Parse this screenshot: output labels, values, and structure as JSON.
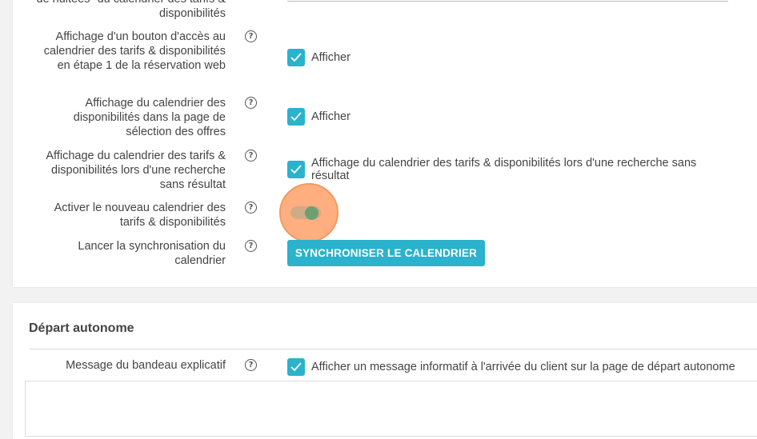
{
  "calendar_settings": {
    "partial_label": "de nuitées\" du calendrier des tarifs & disponibilités",
    "rows": [
      {
        "label": "Affichage d'un bouton d'accès au calendrier des tarifs & disponibilités en étape 1 de la réservation web",
        "checkbox_label": "Afficher",
        "checked": true
      },
      {
        "label": "Affichage du calendrier des disponibilités dans la page de sélection des offres",
        "checkbox_label": "Afficher",
        "checked": true
      },
      {
        "label": "Affichage du calendrier des tarifs & disponibilités lors d'une recherche sans résultat",
        "checkbox_label": "Affichage du calendrier des tarifs & disponibilités lors d'une recherche sans résultat",
        "checked": true
      }
    ],
    "new_calendar": {
      "label": "Activer le nouveau calendrier des tarifs & disponibilités",
      "enabled": true
    },
    "sync": {
      "label": "Lancer la synchronisation du calendrier",
      "button_label": "SYNCHRONISER LE CALENDRIER"
    }
  },
  "autonomous_departure": {
    "title": "Départ autonome",
    "banner_label": "Message du bandeau explicatif",
    "checkbox_label": "Afficher un message informatif à l'arrivée du client sur la page de départ autonome",
    "checked": true
  },
  "help_icon_glyph": "?",
  "colors": {
    "accent": "#2bb2cc",
    "highlight": "#ffa069",
    "toggle_knob": "#6e9f72",
    "background": "#f2f2f2"
  },
  "icons": {
    "help": "question-circle-icon",
    "check": "checkmark-icon"
  }
}
